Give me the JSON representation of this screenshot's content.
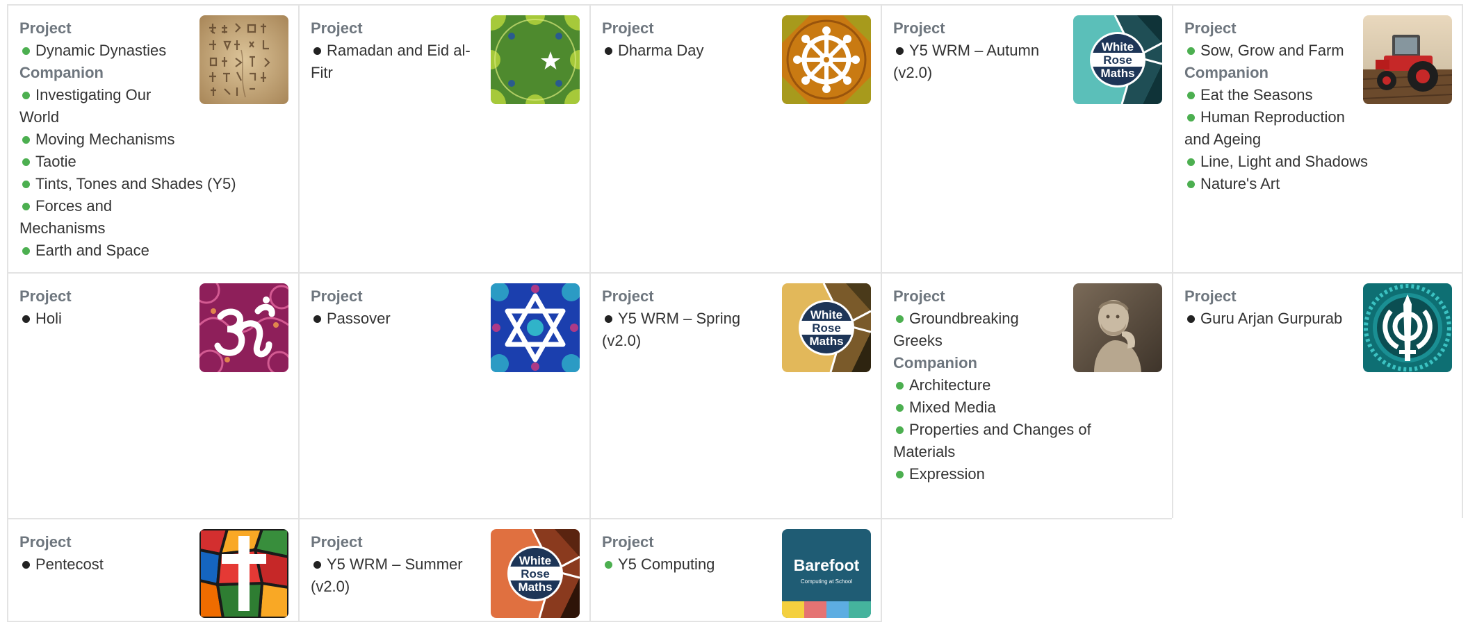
{
  "cells": [
    {
      "project_label": "Project",
      "projects": [
        {
          "label": "Dynamic Dynasties",
          "bullet": "green"
        }
      ],
      "companion_label": "Companion",
      "companions": [
        {
          "label": "Investigating Our World",
          "bullet": "green"
        },
        {
          "label": "Moving Mechanisms",
          "bullet": "green"
        },
        {
          "label": "Taotie",
          "bullet": "green"
        },
        {
          "label": "Tints, Tones and Shades (Y5)",
          "bullet": "green"
        },
        {
          "label": "Forces and Mechanisms",
          "bullet": "green"
        },
        {
          "label": "Earth and Space",
          "bullet": "green"
        }
      ],
      "icon": "ancient-script-tablet-icon"
    },
    {
      "project_label": "Project",
      "projects": [
        {
          "label": "Ramadan and Eid al-Fitr",
          "bullet": "black"
        }
      ],
      "icon": "crescent-star-icon"
    },
    {
      "project_label": "Project",
      "projects": [
        {
          "label": "Dharma Day",
          "bullet": "black"
        }
      ],
      "icon": "dharma-wheel-icon"
    },
    {
      "project_label": "Project",
      "projects": [
        {
          "label": "Y5 WRM – Autumn (v2.0)",
          "bullet": "black"
        }
      ],
      "icon": "white-rose-maths-logo-icon",
      "logo_text": [
        "White",
        "Rose",
        "Maths"
      ],
      "accent": "#5bbfb9"
    },
    {
      "project_label": "Project",
      "projects": [
        {
          "label": "Sow, Grow and Farm",
          "bullet": "green"
        }
      ],
      "companion_label": "Companion",
      "companions": [
        {
          "label": "Eat the Seasons",
          "bullet": "green"
        },
        {
          "label": "Human Reproduction and Ageing",
          "bullet": "green"
        },
        {
          "label": "Line, Light and Shadows",
          "bullet": "green"
        },
        {
          "label": "Nature's Art",
          "bullet": "green"
        }
      ],
      "icon": "tractor-photo-icon"
    },
    {
      "project_label": "Project",
      "projects": [
        {
          "label": "Holi",
          "bullet": "black"
        }
      ],
      "icon": "om-symbol-icon"
    },
    {
      "project_label": "Project",
      "projects": [
        {
          "label": "Passover",
          "bullet": "black"
        }
      ],
      "icon": "star-of-david-icon"
    },
    {
      "project_label": "Project",
      "projects": [
        {
          "label": "Y5 WRM – Spring (v2.0)",
          "bullet": "black"
        }
      ],
      "icon": "white-rose-maths-logo-icon",
      "logo_text": [
        "White",
        "Rose",
        "Maths"
      ],
      "accent": "#e2b85a"
    },
    {
      "project_label": "Project",
      "projects": [
        {
          "label": "Groundbreaking Greeks",
          "bullet": "green"
        }
      ],
      "companion_label": "Companion",
      "companions": [
        {
          "label": "Architecture",
          "bullet": "green"
        },
        {
          "label": "Mixed Media",
          "bullet": "green"
        },
        {
          "label": "Properties and Changes of Materials",
          "bullet": "green"
        },
        {
          "label": "Expression",
          "bullet": "green"
        }
      ],
      "icon": "greek-statue-photo-icon"
    },
    {
      "project_label": "Project",
      "projects": [
        {
          "label": "Guru Arjan Gurpurab",
          "bullet": "black"
        }
      ],
      "icon": "khanda-symbol-icon"
    },
    {
      "project_label": "Project",
      "projects": [
        {
          "label": "Pentecost",
          "bullet": "black"
        }
      ],
      "icon": "stained-glass-cross-icon"
    },
    {
      "project_label": "Project",
      "projects": [
        {
          "label": "Y5 WRM – Summer (v2.0)",
          "bullet": "black"
        }
      ],
      "icon": "white-rose-maths-logo-icon",
      "logo_text": [
        "White",
        "Rose",
        "Maths"
      ],
      "accent": "#e07040"
    },
    {
      "project_label": "Project",
      "projects": [
        {
          "label": "Y5 Computing",
          "bullet": "green"
        }
      ],
      "icon": "barefoot-logo-icon",
      "logo_text": [
        "Barefoot",
        "Computing at School"
      ]
    }
  ],
  "colors": {
    "green_bullet": "#4caf50",
    "black_bullet": "#222222",
    "heading": "#6e767e",
    "border": "#e3e3e3"
  }
}
